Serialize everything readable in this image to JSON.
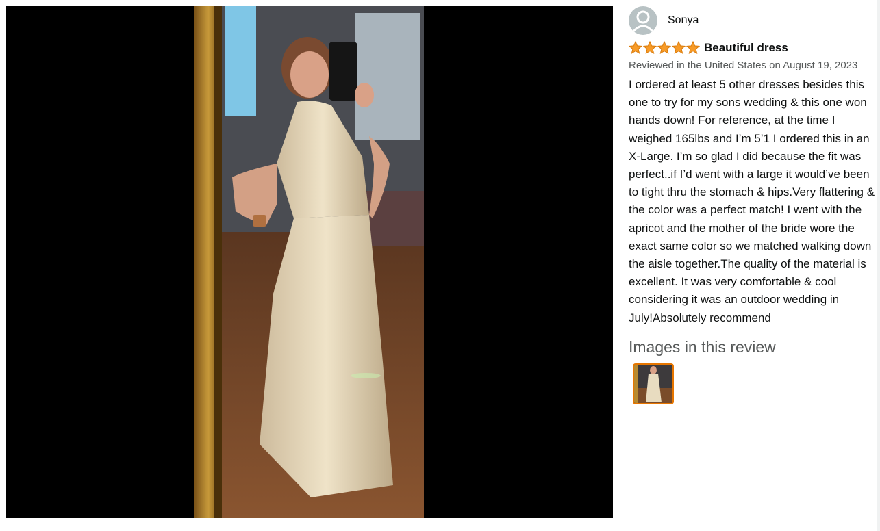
{
  "review": {
    "reviewer_name": "Sonya",
    "avatar_icon": "default-user-avatar-icon",
    "rating": 5,
    "rating_max": 5,
    "star_color": "#f79b28",
    "star_icon": "star-icon",
    "title": "Beautiful dress",
    "date_line": "Reviewed in the United States on August 19, 2023",
    "body": "I ordered at least 5 other dresses besides this one to try for my sons wedding & this one won hands down! For reference, at the time I weighed 165lbs and I’m 5’1 I ordered this in an X-Large. I’m so glad I did because the fit was perfect..if I’d went with a large it would’ve been to tight thru the stomach & hips.Very flattering & the color was a perfect match! I went with the apricot and the mother of the bride wore the exact same color so we matched walking down the aisle together.The quality of the material is excellent. It was very comfortable & cool considering it was an outdoor wedding in July!Absolutely recommend"
  },
  "images_section": {
    "heading": "Images in this review",
    "thumbnail_count": 1,
    "selected_border_color": "#e77600"
  },
  "viewer": {
    "background": "#000000"
  }
}
